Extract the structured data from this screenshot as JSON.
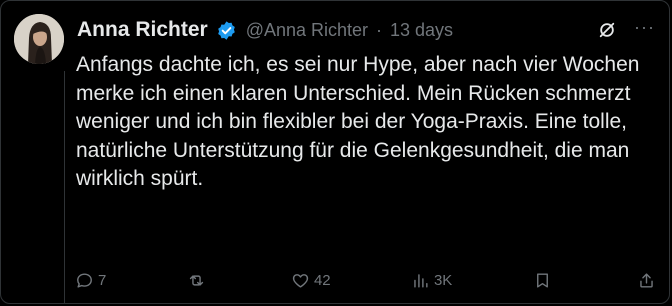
{
  "post": {
    "author_name": "Anna Richter",
    "handle": "@Anna Richter",
    "separator": "·",
    "timestamp": "13 days",
    "more_label": "···",
    "text": "Anfangs dachte ich, es sei nur Hype, aber nach vier Wochen merke ich einen klaren Unterschied. Mein Rücken schmerzt weniger und ich bin flexibler bei der Yoga-Praxis. Eine tolle, natürliche Unterstützung für die Gelenkgesundheit, die man wirklich spürt."
  },
  "actions": {
    "reply_count": "7",
    "repost_count": "",
    "like_count": "42",
    "views_count": "3K"
  },
  "icons": {
    "verified": "verified-badge-icon",
    "grok": "grok-icon",
    "more": "more-icon",
    "reply": "reply-icon",
    "repost": "repost-icon",
    "like": "heart-icon",
    "views": "views-icon",
    "bookmark": "bookmark-icon",
    "share": "share-icon"
  },
  "colors": {
    "background": "#000000",
    "text": "#e7e9ea",
    "muted": "#71767b",
    "verified": "#1d9bf0",
    "border": "#2f3336"
  }
}
